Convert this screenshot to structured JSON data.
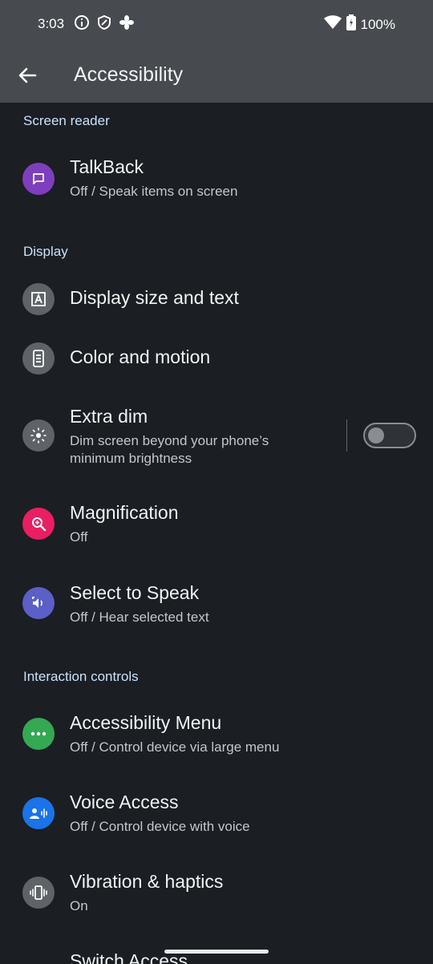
{
  "status_bar": {
    "time": "3:03",
    "battery": "100%",
    "icons": [
      "info-icon",
      "shield-icon",
      "fan-icon",
      "wifi-icon",
      "battery-icon"
    ]
  },
  "header": {
    "title": "Accessibility",
    "back_icon": "arrow-left-icon"
  },
  "sections": {
    "screen_reader": "Screen reader",
    "display": "Display",
    "interaction": "Interaction controls"
  },
  "items": {
    "talkback": {
      "title": "TalkBack",
      "subtitle": "Off / Speak items on screen",
      "icon_color": "#7e3fbf"
    },
    "display_size": {
      "title": "Display size and text",
      "icon_color": "#5f6368"
    },
    "color_motion": {
      "title": "Color and motion",
      "icon_color": "#5f6368"
    },
    "extra_dim": {
      "title": "Extra dim",
      "subtitle": "Dim screen beyond your phone’s minimum brightness",
      "icon_color": "#5f6368",
      "toggle_on": false
    },
    "magnification": {
      "title": "Magnification",
      "subtitle": "Off",
      "icon_color": "#e91e63"
    },
    "select_to_speak": {
      "title": "Select to Speak",
      "subtitle": "Off / Hear selected text",
      "icon_color": "#5b5fc7"
    },
    "a11y_menu": {
      "title": "Accessibility Menu",
      "subtitle": "Off / Control device via large menu",
      "icon_color": "#34a853"
    },
    "voice_access": {
      "title": "Voice Access",
      "subtitle": "Off / Control device with voice",
      "icon_color": "#1a73e8"
    },
    "vibration": {
      "title": "Vibration & haptics",
      "subtitle": "On",
      "icon_color": "#5f6368"
    },
    "switch_access": {
      "title": "Switch Access"
    }
  }
}
